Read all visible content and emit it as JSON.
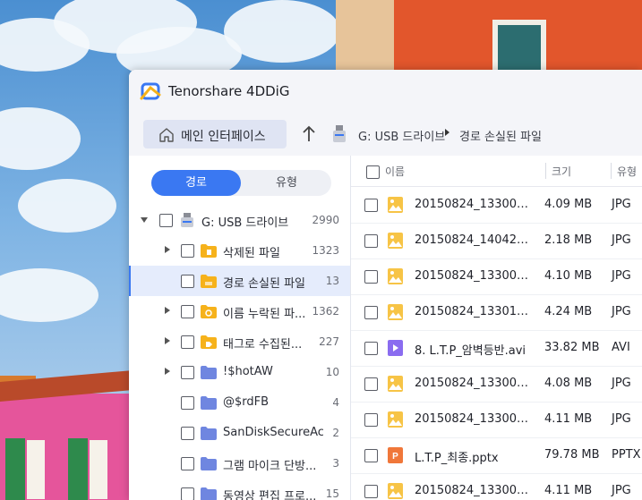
{
  "app": {
    "title": "Tenorshare 4DDiG"
  },
  "nav": {
    "home_label": "메인 인터페이스",
    "breadcrumb": [
      "G: USB 드라이브",
      "경로 손실된 파일"
    ]
  },
  "left": {
    "tabs": [
      {
        "label": "경로",
        "active": true
      },
      {
        "label": "유형",
        "active": false
      }
    ],
    "tree": [
      {
        "label": "G: USB 드라이브",
        "count": "2990",
        "level": 0,
        "icon": "usb-drive-icon",
        "expander": "down"
      },
      {
        "label": "삭제된 파일",
        "count": "1323",
        "level": 1,
        "icon": "deleted-folder-icon",
        "expander": "right"
      },
      {
        "label": "경로 손실된 파일",
        "count": "13",
        "level": 1,
        "icon": "lost-path-folder-icon",
        "expander": "",
        "selected": true
      },
      {
        "label": "이름 누락된 파...",
        "count": "1362",
        "level": 1,
        "icon": "missing-name-folder-icon",
        "expander": "right"
      },
      {
        "label": "태그로 수집된...",
        "count": "227",
        "level": 1,
        "icon": "tag-folder-icon",
        "expander": "right"
      },
      {
        "label": "!$hotAW",
        "count": "10",
        "level": 1,
        "icon": "folder-icon",
        "expander": "right"
      },
      {
        "label": "@$rdFB",
        "count": "4",
        "level": 1,
        "icon": "folder-icon",
        "expander": ""
      },
      {
        "label": "SanDiskSecureAc...",
        "count": "2",
        "level": 1,
        "icon": "folder-icon",
        "expander": ""
      },
      {
        "label": "그램 마이크 단방...",
        "count": "3",
        "level": 1,
        "icon": "folder-icon",
        "expander": ""
      },
      {
        "label": "동영상 편집 프로...",
        "count": "15",
        "level": 1,
        "icon": "folder-icon",
        "expander": ""
      }
    ]
  },
  "table": {
    "headers": {
      "name": "이름",
      "size": "크기",
      "type": "유형"
    },
    "rows": [
      {
        "name": "20150824_133007_...",
        "size": "4.09 MB",
        "type": "JPG",
        "icon": "image-file-icon"
      },
      {
        "name": "20150824_140426.j...",
        "size": "2.18 MB",
        "type": "JPG",
        "icon": "image-file-icon"
      },
      {
        "name": "20150824_133007_...",
        "size": "4.10 MB",
        "type": "JPG",
        "icon": "image-file-icon"
      },
      {
        "name": "20150824_133016_...",
        "size": "4.24 MB",
        "type": "JPG",
        "icon": "image-file-icon"
      },
      {
        "name": "8. L.T.P_암벽등반.avi",
        "size": "33.82 MB",
        "type": "AVI",
        "icon": "video-file-icon"
      },
      {
        "name": "20150824_133007_...",
        "size": "4.08 MB",
        "type": "JPG",
        "icon": "image-file-icon"
      },
      {
        "name": "20150824_133007_...",
        "size": "4.11 MB",
        "type": "JPG",
        "icon": "image-file-icon"
      },
      {
        "name": "L.T.P_최종.pptx",
        "size": "79.78 MB",
        "type": "PPTX",
        "icon": "pptx-file-icon"
      },
      {
        "name": "20150824_133007_...",
        "size": "4.11 MB",
        "type": "JPG",
        "icon": "image-file-icon"
      }
    ]
  },
  "colors": {
    "accent": "#3a78f2",
    "selected_bg": "#e5ecfc",
    "folder": "#f6b21b",
    "folder_blue": "#6f86e0"
  }
}
